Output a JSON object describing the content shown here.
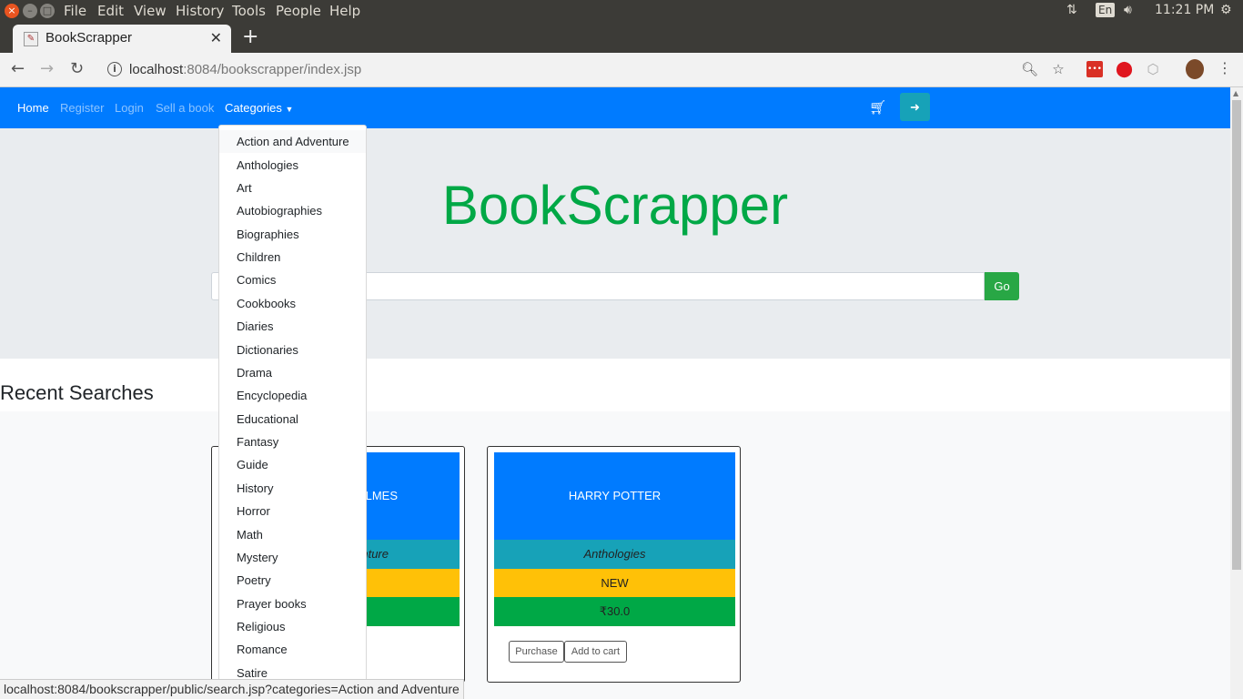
{
  "os": {
    "menu": [
      "File",
      "Edit",
      "View",
      "History",
      "Tools",
      "People",
      "Help"
    ],
    "lang": "En",
    "time": "11:21 PM"
  },
  "browser": {
    "tab_title": "BookScrapper",
    "url_host": "localhost",
    "url_rest": ":8084/bookscrapper/index.jsp",
    "status_url": "localhost:8084/bookscrapper/public/search.jsp?categories=Action and Adventure"
  },
  "navbar": {
    "home": "Home",
    "register": "Register",
    "login": "Login",
    "sell": "Sell a book",
    "categories": "Categories"
  },
  "hero": {
    "brand": "BookScrapper",
    "search_placeholder": "",
    "go_label": "Go"
  },
  "recent": {
    "title": "Recent Searches",
    "cards": [
      {
        "title": "LMES",
        "category": "nture",
        "condition": "",
        "price": ""
      },
      {
        "title": "HARRY POTTER",
        "category": "Anthologies",
        "condition": "NEW",
        "price": "₹30.0",
        "purchase": "Purchase",
        "add_to_cart": "Add to cart"
      }
    ]
  },
  "categories": [
    "Action and Adventure",
    "Anthologies",
    "Art",
    "Autobiographies",
    "Biographies",
    "Children",
    "Comics",
    "Cookbooks",
    "Diaries",
    "Dictionaries",
    "Drama",
    "Encyclopedia",
    "Educational",
    "Fantasy",
    "Guide",
    "History",
    "Horror",
    "Math",
    "Mystery",
    "Poetry",
    "Prayer books",
    "Religious",
    "Romance",
    "Satire"
  ],
  "colors": {
    "navbar": "#007bff",
    "brand": "#00a846",
    "go": "#28a745",
    "info": "#17a2b8",
    "warning": "#ffc107"
  }
}
